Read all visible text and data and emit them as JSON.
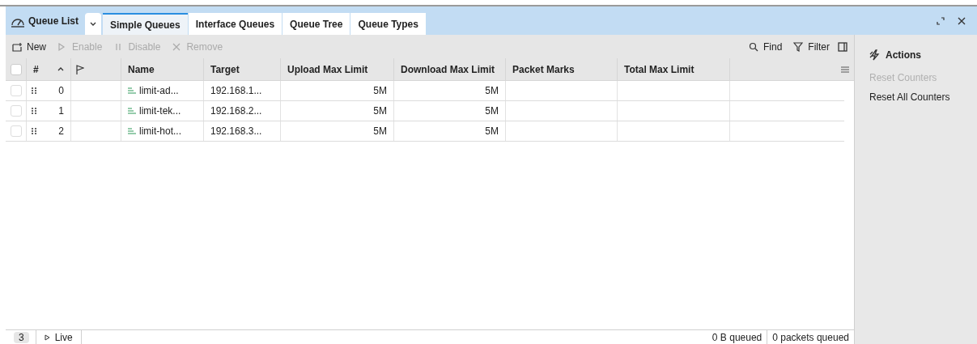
{
  "window": {
    "title": "Queue List"
  },
  "tabs": [
    {
      "label": "Simple Queues",
      "selected": true
    },
    {
      "label": "Interface Queues",
      "selected": false
    },
    {
      "label": "Queue Tree",
      "selected": false
    },
    {
      "label": "Queue Types",
      "selected": false
    }
  ],
  "toolbar": [
    {
      "label": "New",
      "disabled": false
    },
    {
      "label": "Enable",
      "disabled": true
    },
    {
      "label": "Disable",
      "disabled": true
    },
    {
      "label": "Remove",
      "disabled": true
    }
  ],
  "toolbar_right": [
    {
      "label": "Find"
    },
    {
      "label": "Filter"
    }
  ],
  "table": {
    "all_checked": false,
    "columns": [
      "#",
      "Name",
      "Target",
      "Upload Max Limit",
      "Download Max Limit",
      "Packet Marks",
      "Total Max Limit"
    ],
    "rows": [
      {
        "checked": false,
        "cells": [
          "0",
          "limit-ad...",
          "192.168.1...",
          "5M",
          "5M",
          "",
          ""
        ]
      },
      {
        "checked": false,
        "cells": [
          "1",
          "limit-tek...",
          "192.168.2...",
          "5M",
          "5M",
          "",
          ""
        ]
      },
      {
        "checked": false,
        "cells": [
          "2",
          "limit-hot...",
          "192.168.3...",
          "5M",
          "5M",
          "",
          ""
        ]
      }
    ]
  },
  "actions": {
    "title": "Actions",
    "items": [
      {
        "label": "Reset Counters",
        "disabled": true
      },
      {
        "label": "Reset All Counters",
        "disabled": false
      }
    ]
  },
  "status_bar": {
    "count": "3",
    "live": "Live",
    "queued_bytes": "0 B queued",
    "queued_packets": "0 packets queued"
  }
}
